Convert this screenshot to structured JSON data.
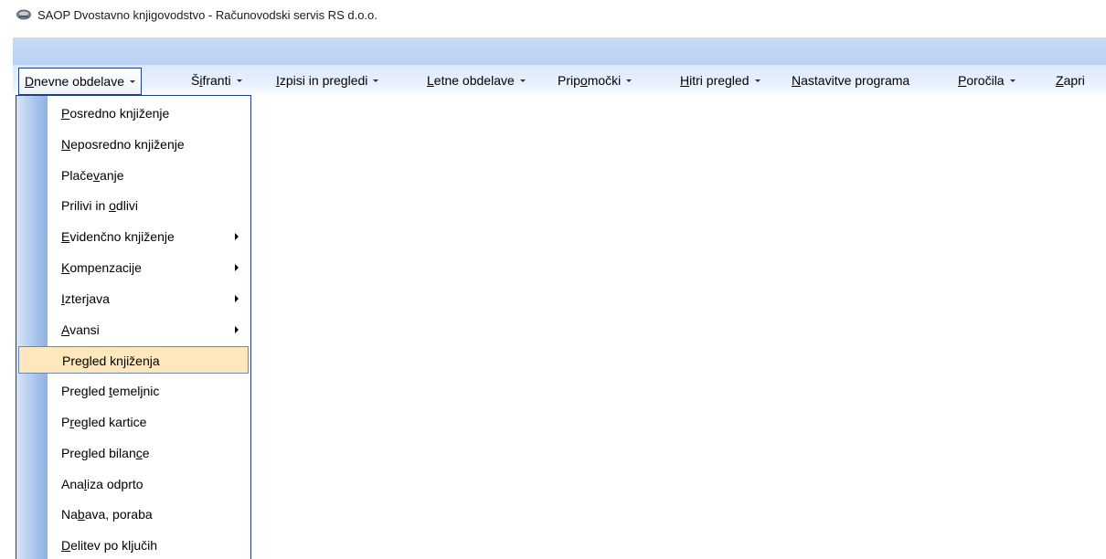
{
  "window": {
    "title": "SAOP Dvostavno knjigovodstvo - Računovodski servis RS d.o.o.",
    "icon": "app-icon"
  },
  "menubar": {
    "items": [
      {
        "label": "Dnevne obdelave",
        "mnemonic_index": 0,
        "has_dropdown": true,
        "open": true
      },
      {
        "label": "Šifranti",
        "mnemonic_index": 1,
        "has_dropdown": true
      },
      {
        "label": "Izpisi in pregledi",
        "mnemonic_index": 0,
        "has_dropdown": true
      },
      {
        "label": "Letne obdelave",
        "mnemonic_index": 0,
        "has_dropdown": true
      },
      {
        "label": "Pripomočki",
        "mnemonic_index": 4,
        "has_dropdown": true
      },
      {
        "label": "Hitri pregled",
        "mnemonic_index": 0,
        "has_dropdown": true
      },
      {
        "label": "Nastavitve programa",
        "mnemonic_index": 0,
        "has_dropdown": false
      },
      {
        "label": "Poročila",
        "mnemonic_index": 0,
        "has_dropdown": true
      },
      {
        "label": "Zapri",
        "mnemonic_index": 0,
        "has_dropdown": false
      }
    ]
  },
  "dropdown": {
    "items": [
      {
        "label": "Posredno knjiženje",
        "mnemonic_index": 0,
        "submenu": false
      },
      {
        "label": "Neposredno knjiženje",
        "mnemonic_index": 0,
        "submenu": false
      },
      {
        "label": "Plačevanje",
        "mnemonic_index": 5,
        "submenu": false
      },
      {
        "label": "Prilivi in odlivi",
        "mnemonic_index": 11,
        "submenu": false
      },
      {
        "label": "Evidenčno knjiženje",
        "mnemonic_index": 0,
        "submenu": true
      },
      {
        "label": "Kompenzacije",
        "mnemonic_index": 0,
        "submenu": true
      },
      {
        "label": "Izterjava",
        "mnemonic_index": 0,
        "submenu": true
      },
      {
        "label": "Avansi",
        "mnemonic_index": 0,
        "submenu": true
      },
      {
        "label": "Pregled knjiženja",
        "mnemonic_index": 3,
        "submenu": false,
        "highlighted": true
      },
      {
        "label": "Pregled temeljnic",
        "mnemonic_index": 8,
        "submenu": false
      },
      {
        "label": "Pregled kartice",
        "mnemonic_index": 1,
        "submenu": false
      },
      {
        "label": "Pregled bilance",
        "mnemonic_index": 13,
        "submenu": false
      },
      {
        "label": "Analiza odprto",
        "mnemonic_index": 3,
        "submenu": false
      },
      {
        "label": "Nabava, poraba",
        "mnemonic_index": 2,
        "submenu": false
      },
      {
        "label": "Delitev po ključih",
        "mnemonic_index": 0,
        "submenu": false
      }
    ]
  },
  "colors": {
    "accent_border": "#1f3f86",
    "highlight": "#fde7bd",
    "menubar_band": "#c9dcf7"
  }
}
